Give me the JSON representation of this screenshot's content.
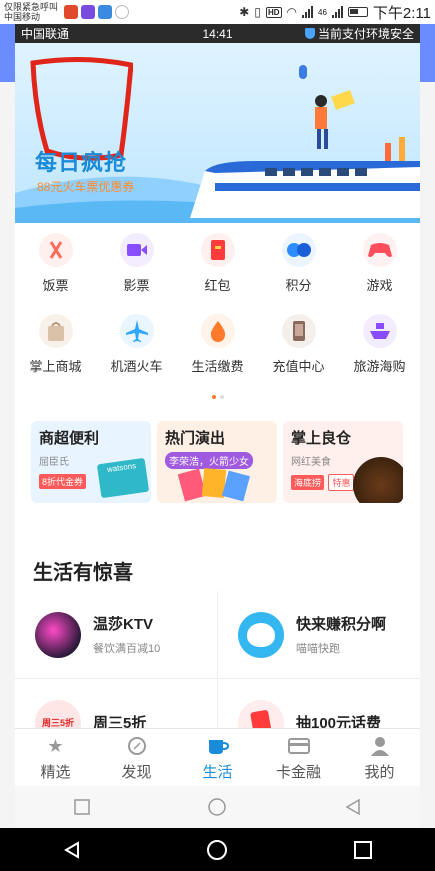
{
  "outer_status": {
    "carrier_line1": "仅限紧急呼叫",
    "carrier_line2": "中国移动",
    "network": "46",
    "time": "下午2:11"
  },
  "inner_status": {
    "carrier": "中国联通",
    "time": "14:41",
    "secure_text": "当前支付环境安全"
  },
  "banner": {
    "title": "每日疯抢",
    "subtitle": "88元火车票优惠券"
  },
  "grid": [
    {
      "label": "饭票",
      "icon": "fork-knife-icon",
      "color": "#ff6b5a",
      "bg": "#fff0ee"
    },
    {
      "label": "影票",
      "icon": "video-camera-icon",
      "color": "#8a4cff",
      "bg": "#f3ecff"
    },
    {
      "label": "红包",
      "icon": "red-envelope-icon",
      "color": "#ff3b3b",
      "bg": "#fff0f0"
    },
    {
      "label": "积分",
      "icon": "points-icon",
      "color": "#2d8cff",
      "bg": "#ecf4ff"
    },
    {
      "label": "游戏",
      "icon": "gamepad-icon",
      "color": "#ff4d5e",
      "bg": "#fff0f2"
    },
    {
      "label": "掌上商城",
      "icon": "shopping-bag-icon",
      "color": "#c8a888",
      "bg": "#f7f1ea"
    },
    {
      "label": "机酒火车",
      "icon": "airplane-icon",
      "color": "#2ea8ff",
      "bg": "#eaf6ff"
    },
    {
      "label": "生活缴费",
      "icon": "water-drop-icon",
      "color": "#ff7a2a",
      "bg": "#fff3ea"
    },
    {
      "label": "充值中心",
      "icon": "phone-icon",
      "color": "#8a6a5a",
      "bg": "#f5efeb"
    },
    {
      "label": "旅游海购",
      "icon": "ship-icon",
      "color": "#8a4cff",
      "bg": "#f3ecff"
    }
  ],
  "promos": [
    {
      "title": "商超便利",
      "sub": "屈臣氏",
      "tag": "8折代金券",
      "brand": "watsons",
      "bg": "#e8f4ff"
    },
    {
      "title": "热门演出",
      "sub": "李荣浩，火箭少女",
      "tag": "",
      "bg": "#fff0e6"
    },
    {
      "title": "掌上良仓",
      "sub": "网红美食",
      "tag": "海底捞",
      "tag2": "特惠",
      "bg": "#fff0ee"
    }
  ],
  "section_title": "生活有惊喜",
  "life_items": [
    [
      {
        "name": "温莎KTV",
        "desc": "餐饮满百减10",
        "avatar_bg": "#2b1a3a"
      },
      {
        "name": "快来赚积分啊",
        "desc": "喵喵快跑",
        "avatar_bg": "#34b6f0"
      }
    ],
    [
      {
        "name": "周三5折",
        "desc": "",
        "avatar_bg": "#ffe6e6",
        "avatar_text": "周三5折"
      },
      {
        "name": "抽100元话费",
        "desc": "",
        "avatar_bg": "#ffecec"
      }
    ]
  ],
  "nav": [
    {
      "label": "精选",
      "icon": "star-icon",
      "active": false
    },
    {
      "label": "发现",
      "icon": "compass-icon",
      "active": false
    },
    {
      "label": "生活",
      "icon": "cup-icon",
      "active": true
    },
    {
      "label": "卡金融",
      "icon": "card-icon",
      "active": false
    },
    {
      "label": "我的",
      "icon": "user-icon",
      "active": false
    }
  ]
}
